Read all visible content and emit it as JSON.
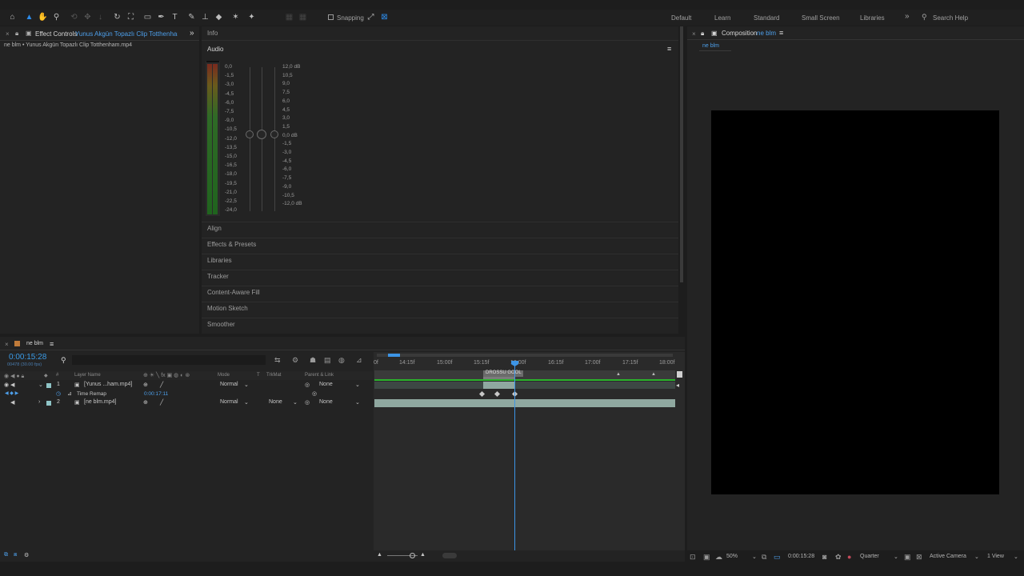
{
  "toolbar": {
    "tools": [
      "home-icon",
      "selection-icon",
      "hand-icon",
      "zoom-icon",
      "orbit-icon",
      "move-icon",
      "pan-icon",
      "rotate-icon",
      "camera-icon",
      "rectangle-icon",
      "pen-icon",
      "text-icon",
      "brush-icon",
      "clone-stamp-icon",
      "eraser-icon",
      "roto-brush-icon",
      "puppet-pin-icon"
    ],
    "snapping_label": "Snapping",
    "workspaces": [
      "Default",
      "Learn",
      "Standard",
      "Small Screen",
      "Libraries"
    ],
    "more": "»",
    "search_placeholder": "Search Help"
  },
  "effect_controls": {
    "tab_label": "Effect Controls",
    "tab_layer": "Yunus Akgün Topazlı Clip Totthenham.r",
    "subtitle": "ne blm • Yunus Akgün Topazlı Clip Totthenham.mp4"
  },
  "info": {
    "label": "Info"
  },
  "audio": {
    "label": "Audio",
    "left_scale": [
      "0,0",
      "-1,5",
      "-3,0",
      "-4,5",
      "-6,0",
      "-7,5",
      "-9,0",
      "-10,5",
      "-12,0",
      "-13,5",
      "-15,0",
      "-16,5",
      "-18,0",
      "-19,5",
      "-21,0",
      "-22,5",
      "-24,0"
    ],
    "right_scale": [
      "12,0 dB",
      "10,5",
      "9,0",
      "7,5",
      "6,0",
      "4,5",
      "3,0",
      "1,5",
      "0,0 dB",
      "-1,5",
      "-3,0",
      "-4,5",
      "-6,0",
      "-7,5",
      "-9,0",
      "-10,5",
      "-12,0 dB"
    ]
  },
  "panels": [
    "Align",
    "Effects & Presets",
    "Libraries",
    "Tracker",
    "Content-Aware Fill",
    "Motion Sketch",
    "Smoother"
  ],
  "composition": {
    "tab_label": "Composition",
    "tab_name": "ne blm",
    "subtab": "ne blm",
    "zoom": "50%",
    "timecode": "0:00:15:28",
    "resolution": "Quarter",
    "camera": "Active Camera",
    "views": "1 View"
  },
  "timeline": {
    "comp_tab": "ne blm",
    "timecode": "0:00:15:28",
    "frames": "00478 (30.00 fps)",
    "headers": {
      "layer_name": "Layer Name",
      "mode": "Mode",
      "t": "T",
      "trkmat": "TrkMat",
      "parent": "Parent & Link"
    },
    "layers": [
      {
        "num": "1",
        "name": "[Yunus ...ham.mp4]",
        "mode": "Normal",
        "trkmat": "",
        "parent": "None"
      },
      {
        "num": "2",
        "name": "[ne blm.mp4]",
        "mode": "Normal",
        "trkmat": "None",
        "parent": "None"
      }
    ],
    "time_remap": {
      "label": "Time Remap",
      "value": "0:00:17:11"
    },
    "ruler": [
      "0f",
      "14:15f",
      "15:00f",
      "15:15f",
      "16:00f",
      "16:15f",
      "17:00f",
      "17:15f",
      "18:00f"
    ],
    "marker_label": "DROSSU GOOL"
  },
  "colors": {
    "accent": "#2d8ceb",
    "layer_bar": "#8fa8a0",
    "playhead": "#3d95e6",
    "timecode": "#3a9be6"
  }
}
